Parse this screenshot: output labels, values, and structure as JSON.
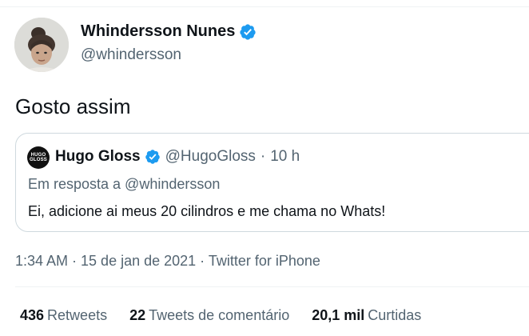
{
  "author": {
    "name": "Whindersson Nunes",
    "handle": "@whindersson",
    "verified_color": "#1d9bf0"
  },
  "tweet": {
    "text": "Gosto assim"
  },
  "quoted": {
    "avatar_text_top": "HUGO",
    "avatar_text_bottom": "GLOSS",
    "name": "Hugo Gloss",
    "handle": "@HugoGloss",
    "separator": "·",
    "time": "10 h",
    "reply_to": "Em resposta a @whindersson",
    "text": "Ei, adicione ai meus 20 cilindros e me chama no Whats!"
  },
  "meta": {
    "timestamp": "1:34 AM · 15 de jan de 2021 · Twitter for iPhone"
  },
  "stats": {
    "retweets_count": "436",
    "retweets_label": "Retweets",
    "comments_count": "22",
    "comments_label": "Tweets de comentário",
    "likes_count": "20,1 mil",
    "likes_label": "Curtidas"
  }
}
